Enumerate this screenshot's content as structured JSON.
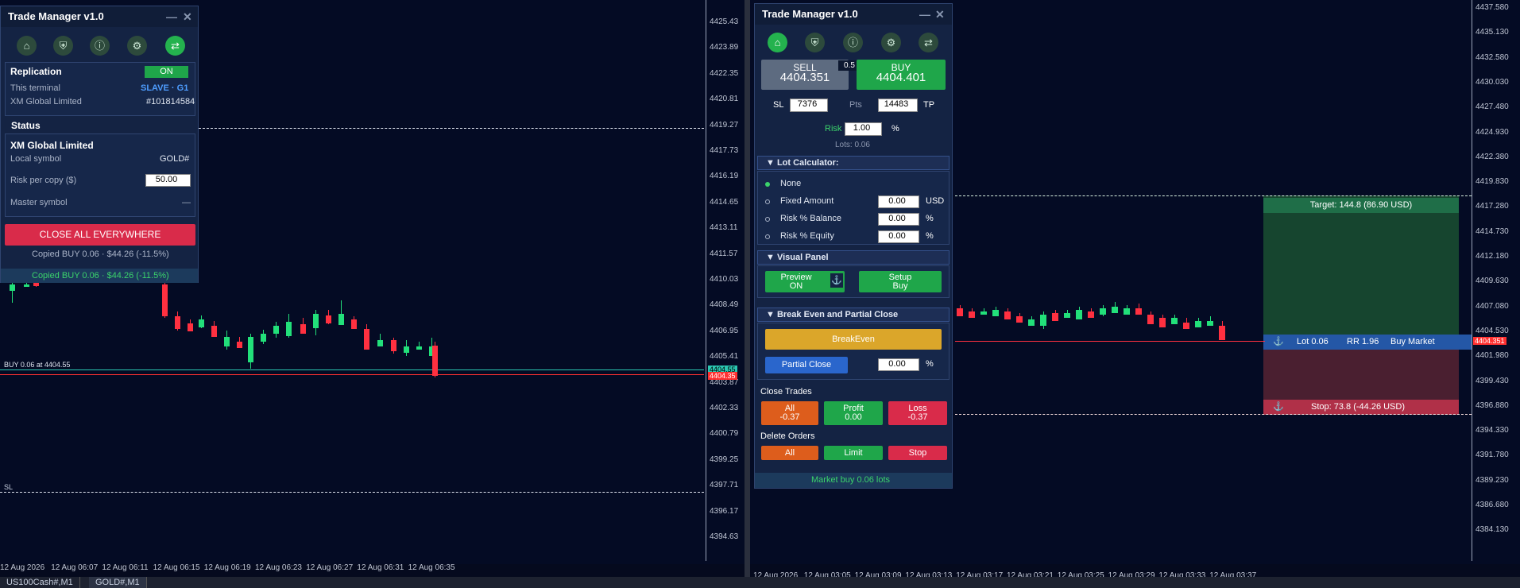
{
  "left_chart": {
    "prices": [
      "4425.43",
      "4423.89",
      "4422.35",
      "4420.81",
      "4419.27",
      "4417.73",
      "4416.19",
      "4414.65",
      "4413.11",
      "4411.57",
      "4410.03",
      "4408.49",
      "4406.95",
      "4405.41",
      "4403.87",
      "4402.33",
      "4400.79",
      "4399.25",
      "4397.71",
      "4396.17",
      "4394.63"
    ],
    "times": [
      "12 Aug 2026",
      "12 Aug 06:07",
      "12 Aug 06:11",
      "12 Aug 06:15",
      "12 Aug 06:19",
      "12 Aug 06:23",
      "12 Aug 06:27",
      "12 Aug 06:31",
      "12 Aug 06:35"
    ],
    "buy_line_label": "BUY 0.06 at 4404.55",
    "sl_label": "SL",
    "price_tag_buy": "4404.55",
    "price_tag_current": "4404.35"
  },
  "right_chart": {
    "prices": [
      "4437.580",
      "4435.130",
      "4432.580",
      "4430.030",
      "4427.480",
      "4424.930",
      "4422.380",
      "4419.830",
      "4417.280",
      "4414.730",
      "4412.180",
      "4409.630",
      "4407.080",
      "4404.530",
      "4401.980",
      "4399.430",
      "4396.880",
      "4394.330",
      "4391.780",
      "4389.230",
      "4386.680",
      "4384.130"
    ],
    "times": [
      "12 Aug 2026",
      "12 Aug 03:05",
      "12 Aug 03:09",
      "12 Aug 03:13",
      "12 Aug 03:17",
      "12 Aug 03:21",
      "12 Aug 03:25",
      "12 Aug 03:29",
      "12 Aug 03:33",
      "12 Aug 03:37"
    ],
    "target_label": "Target: 144.8 (86.90 USD)",
    "entry_lot": "Lot 0.06",
    "entry_rr": "RR 1.96",
    "entry_type": "Buy Market",
    "stop_label": "Stop: 73.8 (-44.26 USD)",
    "price_tag": "4404.351",
    "anchor_icon": "⚓"
  },
  "tabs": [
    "US100Cash#,M1",
    "GOLD#,M1"
  ],
  "left_panel": {
    "title": "Trade Manager v1.0",
    "replication_label": "Replication",
    "replication_toggle": "ON",
    "this_terminal_label": "This terminal",
    "this_terminal_value": "SLAVE · G1",
    "broker_label": "XM Global Limited",
    "account": "#101814584",
    "status_header": "Status",
    "status_broker": "XM Global Limited",
    "local_symbol_label": "Local symbol",
    "local_symbol_value": "GOLD#",
    "risk_label": "Risk per copy ($)",
    "risk_value": "50.00",
    "master_symbol_label": "Master symbol",
    "master_symbol_value": "—",
    "close_all": "CLOSE ALL EVERYWHERE",
    "log1": "Copied BUY 0.06  ·  $44.26 (-11.5%)",
    "log2": "Copied BUY 0.06  ·  $44.26 (-11.5%)"
  },
  "right_panel": {
    "title": "Trade Manager v1.0",
    "sell_label": "SELL",
    "sell_price": "4404.351",
    "spread": "0.5",
    "buy_label": "BUY",
    "buy_price": "4404.401",
    "sl_label": "SL",
    "sl_value": "7376",
    "pts_label": "Pts",
    "tp_value": "14483",
    "tp_label": "TP",
    "risk_label": "Risk",
    "risk_value": "1.00",
    "risk_unit": "%",
    "lots": "Lots: 0.06",
    "lot_calc_header": "▼ Lot Calculator:",
    "opt_none": "None",
    "opt_fixed": "Fixed Amount",
    "opt_fixed_value": "0.00",
    "opt_fixed_unit": "USD",
    "opt_balance": "Risk % Balance",
    "opt_balance_value": "0.00",
    "opt_balance_unit": "%",
    "opt_equity": "Risk % Equity",
    "opt_equity_value": "0.00",
    "opt_equity_unit": "%",
    "visual_header": "▼ Visual Panel",
    "preview_btn": "Preview\nON",
    "setup_btn": "Setup\nBuy",
    "be_header": "▼ Break Even and Partial Close",
    "breakeven_btn": "BreakEven",
    "partial_btn": "Partial Close",
    "partial_value": "0.00",
    "partial_unit": "%",
    "close_trades_label": "Close Trades",
    "close_all_btn": "All\n-0.37",
    "close_profit_btn": "Profit\n0.00",
    "close_loss_btn": "Loss\n-0.37",
    "delete_orders_label": "Delete Orders",
    "del_all": "All",
    "del_limit": "Limit",
    "del_stop": "Stop",
    "status_msg": "Market buy 0.06 lots"
  }
}
